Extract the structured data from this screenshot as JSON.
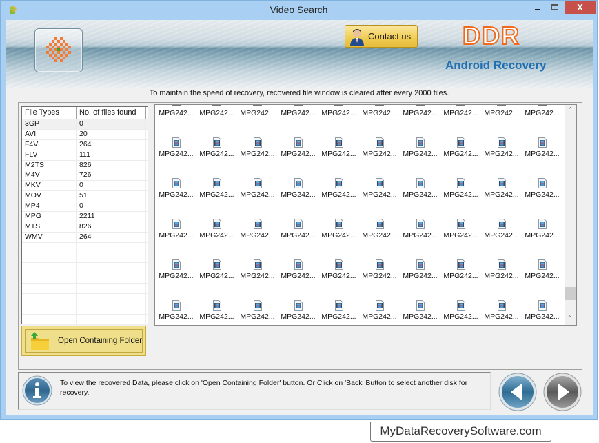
{
  "window": {
    "title": "Video Search",
    "close_label": "X"
  },
  "header": {
    "contact_label": "Contact us",
    "brand": "DDR",
    "product": "Android Recovery",
    "colors": {
      "brand": "#f06a1e",
      "product": "#1f6fb3"
    }
  },
  "notice": "To maintain the speed of recovery, recovered file window is cleared after every 2000 files.",
  "file_types_table": {
    "columns": [
      "File Types",
      "No. of files found"
    ],
    "rows": [
      {
        "type": "3GP",
        "count": "0"
      },
      {
        "type": "AVI",
        "count": "20"
      },
      {
        "type": "F4V",
        "count": "264"
      },
      {
        "type": "FLV",
        "count": "111"
      },
      {
        "type": "M2TS",
        "count": "826"
      },
      {
        "type": "M4V",
        "count": "726"
      },
      {
        "type": "MKV",
        "count": "0"
      },
      {
        "type": "MOV",
        "count": "51"
      },
      {
        "type": "MP4",
        "count": "0"
      },
      {
        "type": "MPG",
        "count": "2211"
      },
      {
        "type": "MTS",
        "count": "826"
      },
      {
        "type": "WMV",
        "count": "264"
      }
    ],
    "empty_rows": 10
  },
  "open_folder_button": {
    "label": "Open Containing Folder"
  },
  "file_grid": {
    "item_label": "MPG242...",
    "columns": 10,
    "rows": 6,
    "icon": "video-file-icon",
    "scroll_position_fraction": 0.93
  },
  "info_panel": {
    "text": "To view the recovered Data, please click on 'Open Containing Folder' button. Or Click on 'Back' Button to select another disk for recovery."
  },
  "nav": {
    "back": "back-arrow-icon",
    "next": "next-arrow-icon"
  },
  "footer": {
    "label": "MyDataRecoverySoftware.com"
  }
}
